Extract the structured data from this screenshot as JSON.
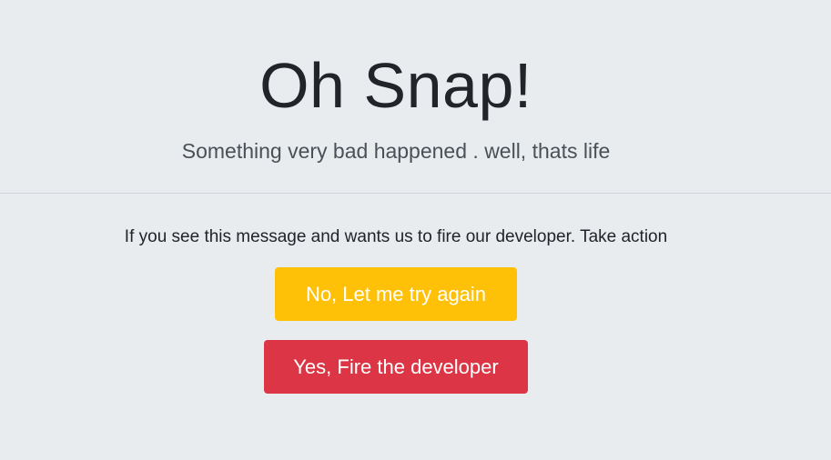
{
  "header": {
    "title": "Oh Snap!",
    "subtitle": "Something very bad happened . well, thats life"
  },
  "main": {
    "message": "If you see this message and wants us to fire our developer. Take action",
    "retry_label": "No, Let me try again",
    "fire_label": "Yes, Fire the developer"
  },
  "colors": {
    "background": "#e9ecef",
    "warning": "#ffc107",
    "danger": "#dc3545"
  }
}
